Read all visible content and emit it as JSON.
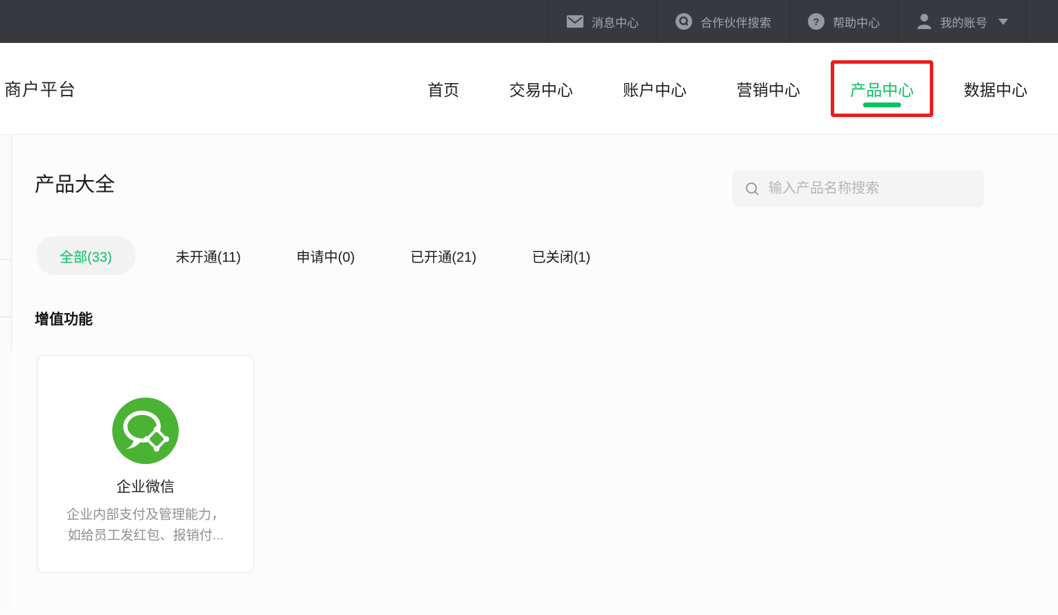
{
  "colors": {
    "topbar_bg": "#37393f",
    "accent_green": "#07c160",
    "logo_green": "#4bb334",
    "annotation_red": "#ee1c1c",
    "tab_pill_bg": "#f2f2f3",
    "search_bg": "#f4f4f5"
  },
  "topbar": {
    "items": [
      {
        "icon": "mail-icon",
        "label": "消息中心"
      },
      {
        "icon": "search-circle-icon",
        "label": "合作伙伴搜索"
      },
      {
        "icon": "help-circle-icon",
        "label": "帮助中心"
      },
      {
        "icon": "user-icon",
        "label": "我的账号",
        "has_dropdown": true
      }
    ]
  },
  "header": {
    "brand": "商户平台",
    "nav": [
      {
        "label": "首页",
        "active": false
      },
      {
        "label": "交易中心",
        "active": false
      },
      {
        "label": "账户中心",
        "active": false
      },
      {
        "label": "营销中心",
        "active": false
      },
      {
        "label": "产品中心",
        "active": true,
        "annotated": true
      },
      {
        "label": "数据中心",
        "active": false
      }
    ]
  },
  "main": {
    "title": "产品大全",
    "search": {
      "placeholder": "输入产品名称搜索",
      "value": "",
      "icon": "search-icon"
    },
    "tabs": [
      {
        "label": "全部(33)",
        "active": true
      },
      {
        "label": "未开通(11)",
        "active": false
      },
      {
        "label": "申请中(0)",
        "active": false
      },
      {
        "label": "已开通(21)",
        "active": false
      },
      {
        "label": "已关闭(1)",
        "active": false
      }
    ],
    "section_title": "增值功能",
    "products": [
      {
        "icon": "wecom-icon",
        "name": "企业微信",
        "description_lines": [
          "企业内部支付及管理能力，",
          "如给员工发红包、报销付..."
        ]
      }
    ]
  }
}
